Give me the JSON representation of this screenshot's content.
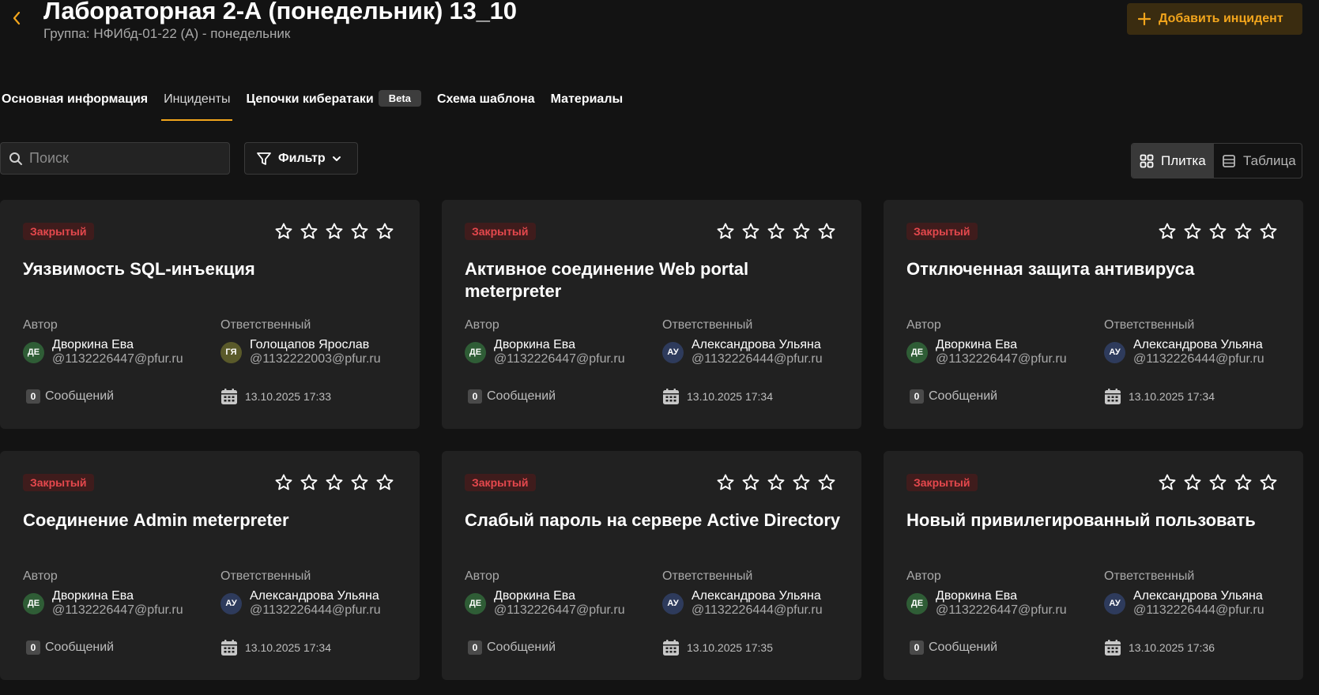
{
  "header": {
    "title": "Лабораторная 2-А (понедельник) 13_10",
    "subtitle": "Группа: НФИбд-01-22 (А) - понедельник",
    "add_button_label": "Добавить инцидент"
  },
  "tabs": [
    {
      "label": "Основная информация",
      "active": false
    },
    {
      "label": "Инциденты",
      "active": true
    },
    {
      "label": "Цепочки кибератаки",
      "badge": "Beta",
      "active": false
    },
    {
      "label": "Схема шаблона",
      "active": false
    },
    {
      "label": "Материалы",
      "active": false
    }
  ],
  "toolbar": {
    "search_placeholder": "Поиск",
    "filter_label": "Фильтр",
    "view_tile_label": "Плитка",
    "view_table_label": "Таблица",
    "active_view": "tile"
  },
  "labels": {
    "author": "Автор",
    "responsible": "Ответственный",
    "messages": "Сообщений"
  },
  "colors": {
    "accent": "#f2a51c",
    "status_closed": "#e5484d",
    "avatar_green": "#2f5d36",
    "avatar_olive": "#5a5a2a",
    "avatar_blue": "#2e3b5c"
  },
  "incidents": [
    {
      "status": "Закрытый",
      "rating": 0,
      "title": "Уязвимость SQL-инъекция",
      "author": {
        "initials": "ДЕ",
        "name": "Дворкина Ева",
        "email": "@1132226447@pfur.ru",
        "color": "#2f5d36"
      },
      "responsible": {
        "initials": "ГЯ",
        "name": "Голощапов Ярослав",
        "email": "@1132222003@pfur.ru",
        "color": "#5a5a2a"
      },
      "messages_count": "0",
      "date": "13.10.2025 17:33"
    },
    {
      "status": "Закрытый",
      "rating": 0,
      "title": "Активное соединение Web portal meterpreter",
      "author": {
        "initials": "ДЕ",
        "name": "Дворкина Ева",
        "email": "@1132226447@pfur.ru",
        "color": "#2f5d36"
      },
      "responsible": {
        "initials": "АУ",
        "name": "Александрова Ульяна",
        "email": "@1132226444@pfur.ru",
        "color": "#2e3b5c"
      },
      "messages_count": "0",
      "date": "13.10.2025 17:34"
    },
    {
      "status": "Закрытый",
      "rating": 0,
      "title": "Отключенная защита антивируса",
      "author": {
        "initials": "ДЕ",
        "name": "Дворкина Ева",
        "email": "@1132226447@pfur.ru",
        "color": "#2f5d36"
      },
      "responsible": {
        "initials": "АУ",
        "name": "Александрова Ульяна",
        "email": "@1132226444@pfur.ru",
        "color": "#2e3b5c"
      },
      "messages_count": "0",
      "date": "13.10.2025 17:34"
    },
    {
      "status": "Закрытый",
      "rating": 0,
      "title": "Соединение Admin meterpreter",
      "author": {
        "initials": "ДЕ",
        "name": "Дворкина Ева",
        "email": "@1132226447@pfur.ru",
        "color": "#2f5d36"
      },
      "responsible": {
        "initials": "АУ",
        "name": "Александрова Ульяна",
        "email": "@1132226444@pfur.ru",
        "color": "#2e3b5c"
      },
      "messages_count": "0",
      "date": "13.10.2025 17:34"
    },
    {
      "status": "Закрытый",
      "rating": 0,
      "title": "Слабый пароль на сервере Active Directory",
      "author": {
        "initials": "ДЕ",
        "name": "Дворкина Ева",
        "email": "@1132226447@pfur.ru",
        "color": "#2f5d36"
      },
      "responsible": {
        "initials": "АУ",
        "name": "Александрова Ульяна",
        "email": "@1132226444@pfur.ru",
        "color": "#2e3b5c"
      },
      "messages_count": "0",
      "date": "13.10.2025 17:35"
    },
    {
      "status": "Закрытый",
      "rating": 0,
      "title": "Новый привилегированный пользовать",
      "author": {
        "initials": "ДЕ",
        "name": "Дворкина Ева",
        "email": "@1132226447@pfur.ru",
        "color": "#2f5d36"
      },
      "responsible": {
        "initials": "АУ",
        "name": "Александрова Ульяна",
        "email": "@1132226444@pfur.ru",
        "color": "#2e3b5c"
      },
      "messages_count": "0",
      "date": "13.10.2025 17:36"
    }
  ]
}
